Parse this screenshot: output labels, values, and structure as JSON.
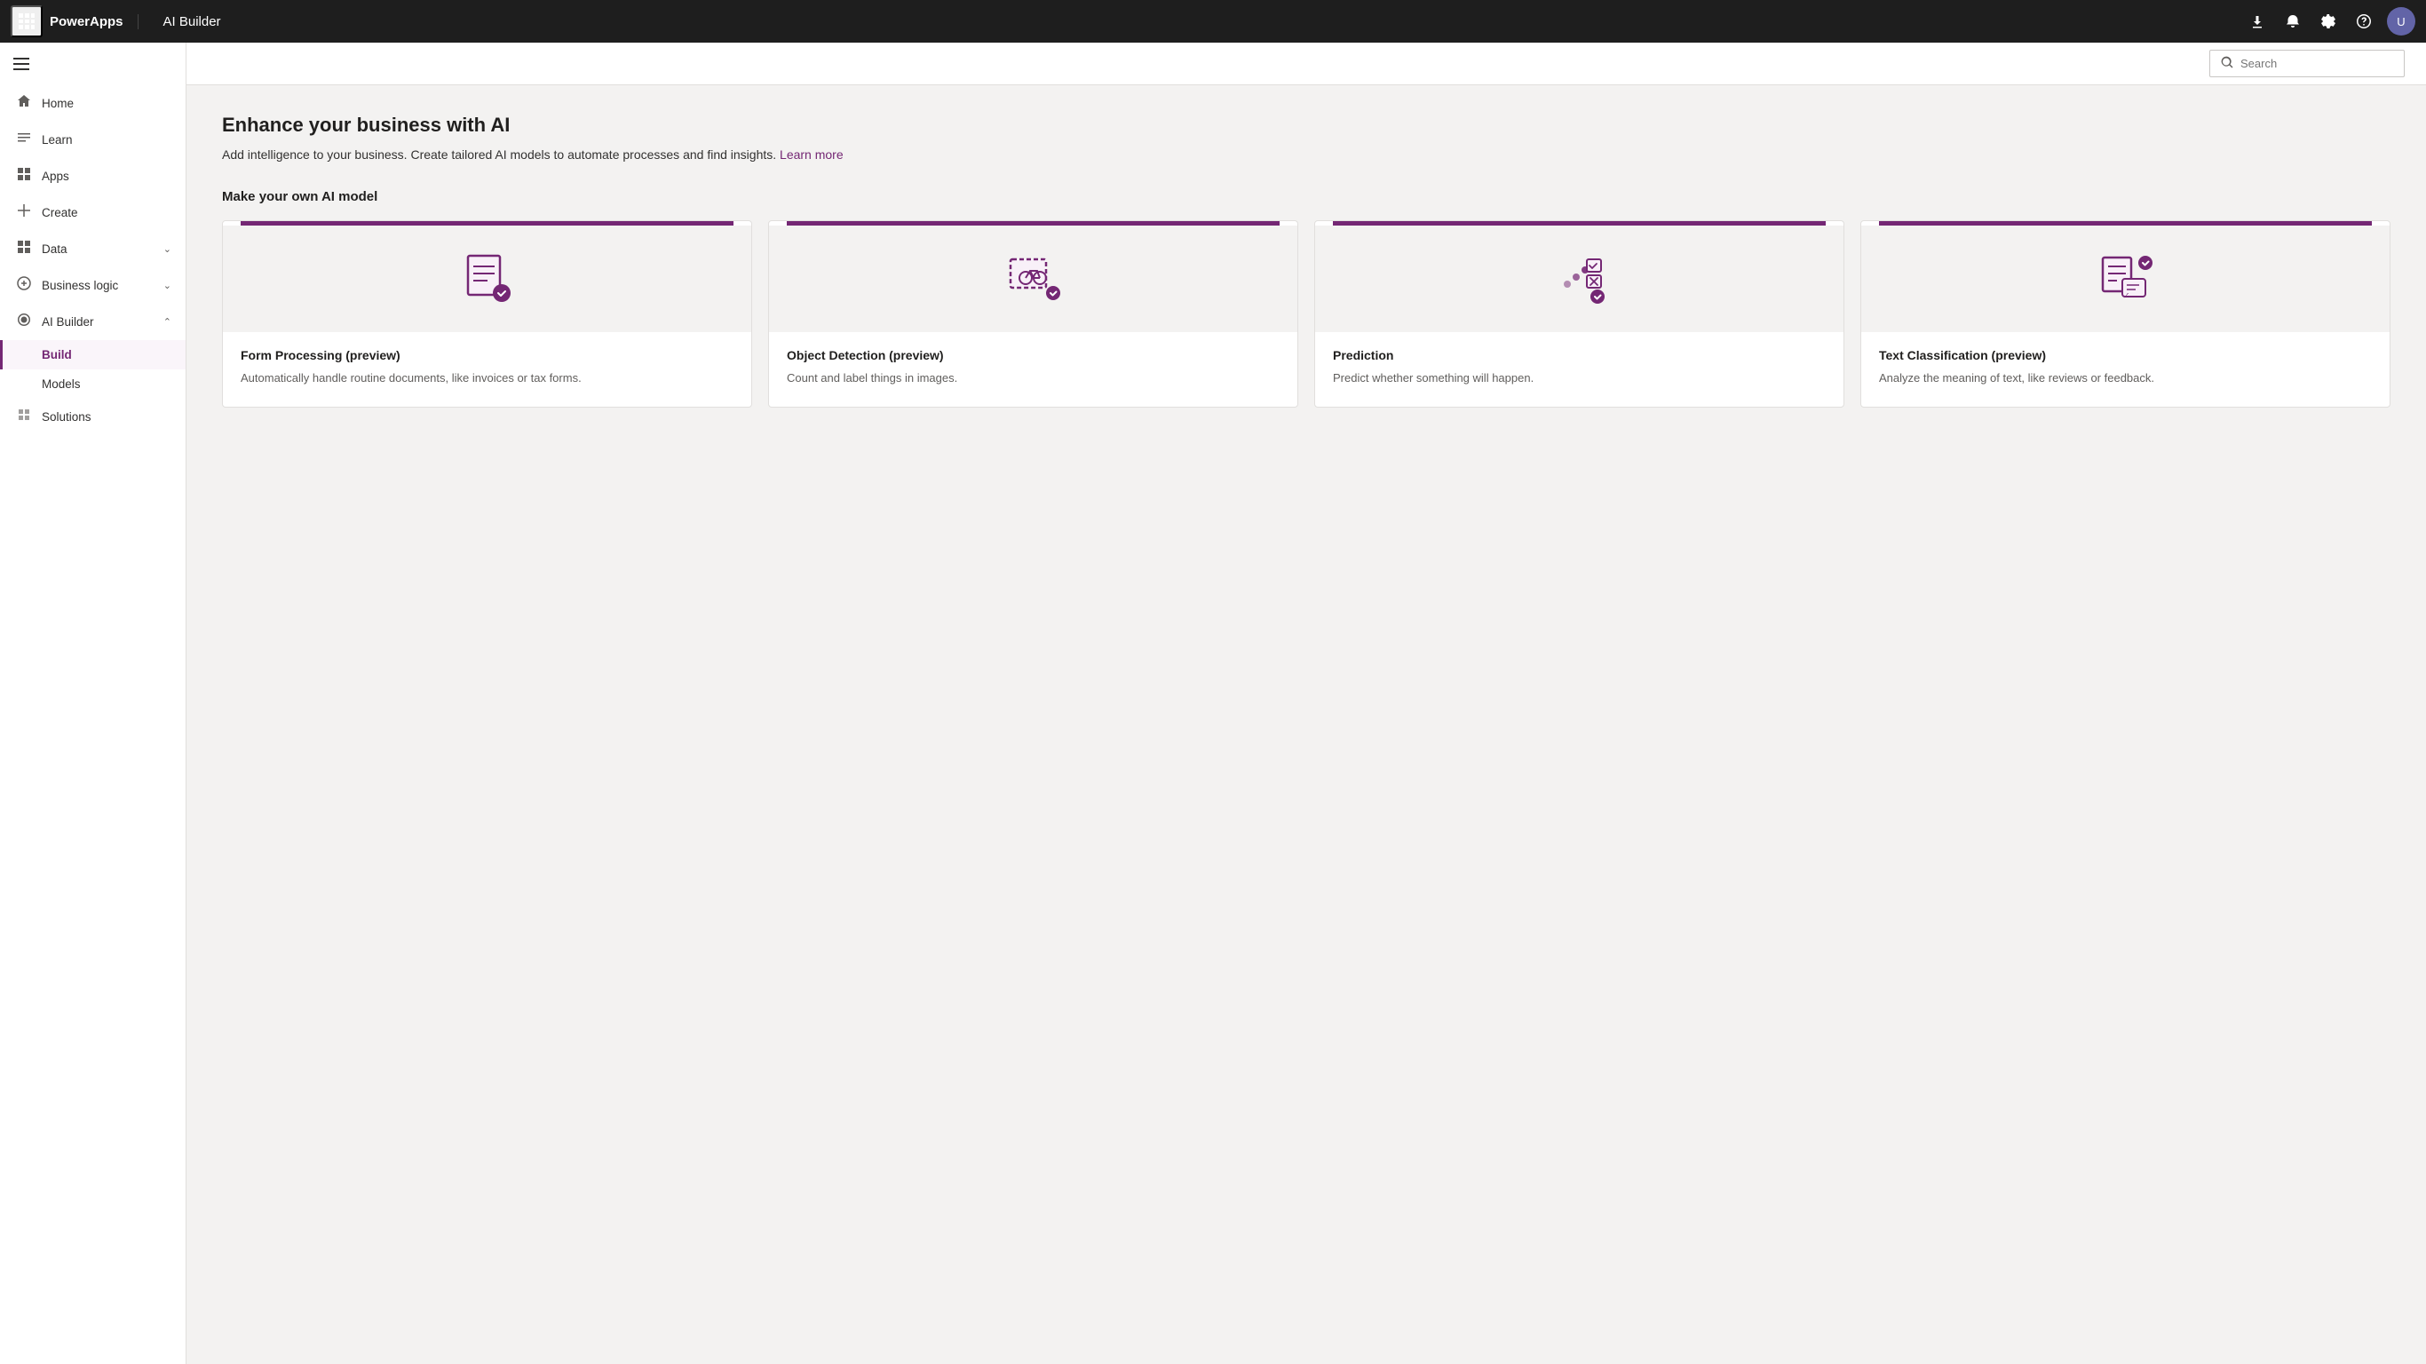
{
  "topnav": {
    "powerapps_label": "PowerApps",
    "app_name": "AI Builder",
    "waffle_icon": "⊞",
    "download_icon": "⬇",
    "notifications_icon": "🔔",
    "settings_icon": "⚙",
    "help_icon": "?",
    "avatar_initials": "U"
  },
  "search": {
    "placeholder": "Search"
  },
  "sidebar": {
    "toggle_icon": "≡",
    "items": [
      {
        "id": "home",
        "label": "Home",
        "icon": "⌂",
        "active": false
      },
      {
        "id": "learn",
        "label": "Learn",
        "icon": "📖",
        "active": false
      },
      {
        "id": "apps",
        "label": "Apps",
        "icon": "⊞",
        "active": false
      },
      {
        "id": "create",
        "label": "Create",
        "icon": "+",
        "active": false
      },
      {
        "id": "data",
        "label": "Data",
        "icon": "⊞",
        "active": false,
        "expandable": true
      },
      {
        "id": "business-logic",
        "label": "Business logic",
        "icon": "⚙",
        "active": false,
        "expandable": true
      },
      {
        "id": "ai-builder",
        "label": "AI Builder",
        "icon": "◈",
        "active": false,
        "expandable": true,
        "expanded": true
      }
    ],
    "ai_builder_sub": [
      {
        "id": "build",
        "label": "Build",
        "active": true
      },
      {
        "id": "models",
        "label": "Models",
        "active": false
      }
    ],
    "solutions_item": {
      "id": "solutions",
      "label": "Solutions",
      "icon": "◇",
      "active": false
    }
  },
  "main": {
    "heading": "Enhance your business with AI",
    "subtext": "Add intelligence to your business. Create tailored AI models to automate processes and find insights.",
    "learn_more_label": "Learn more",
    "section_heading": "Make your own AI model",
    "cards": [
      {
        "id": "form-processing",
        "title": "Form Processing (preview)",
        "description": "Automatically handle routine documents, like invoices or tax forms."
      },
      {
        "id": "object-detection",
        "title": "Object Detection (preview)",
        "description": "Count and label things in images."
      },
      {
        "id": "prediction",
        "title": "Prediction",
        "description": "Predict whether something will happen."
      },
      {
        "id": "text-classification",
        "title": "Text Classification (preview)",
        "description": "Analyze the meaning of text, like reviews or feedback."
      }
    ]
  },
  "colors": {
    "accent": "#742774",
    "nav_bg": "#1e1e1e"
  }
}
